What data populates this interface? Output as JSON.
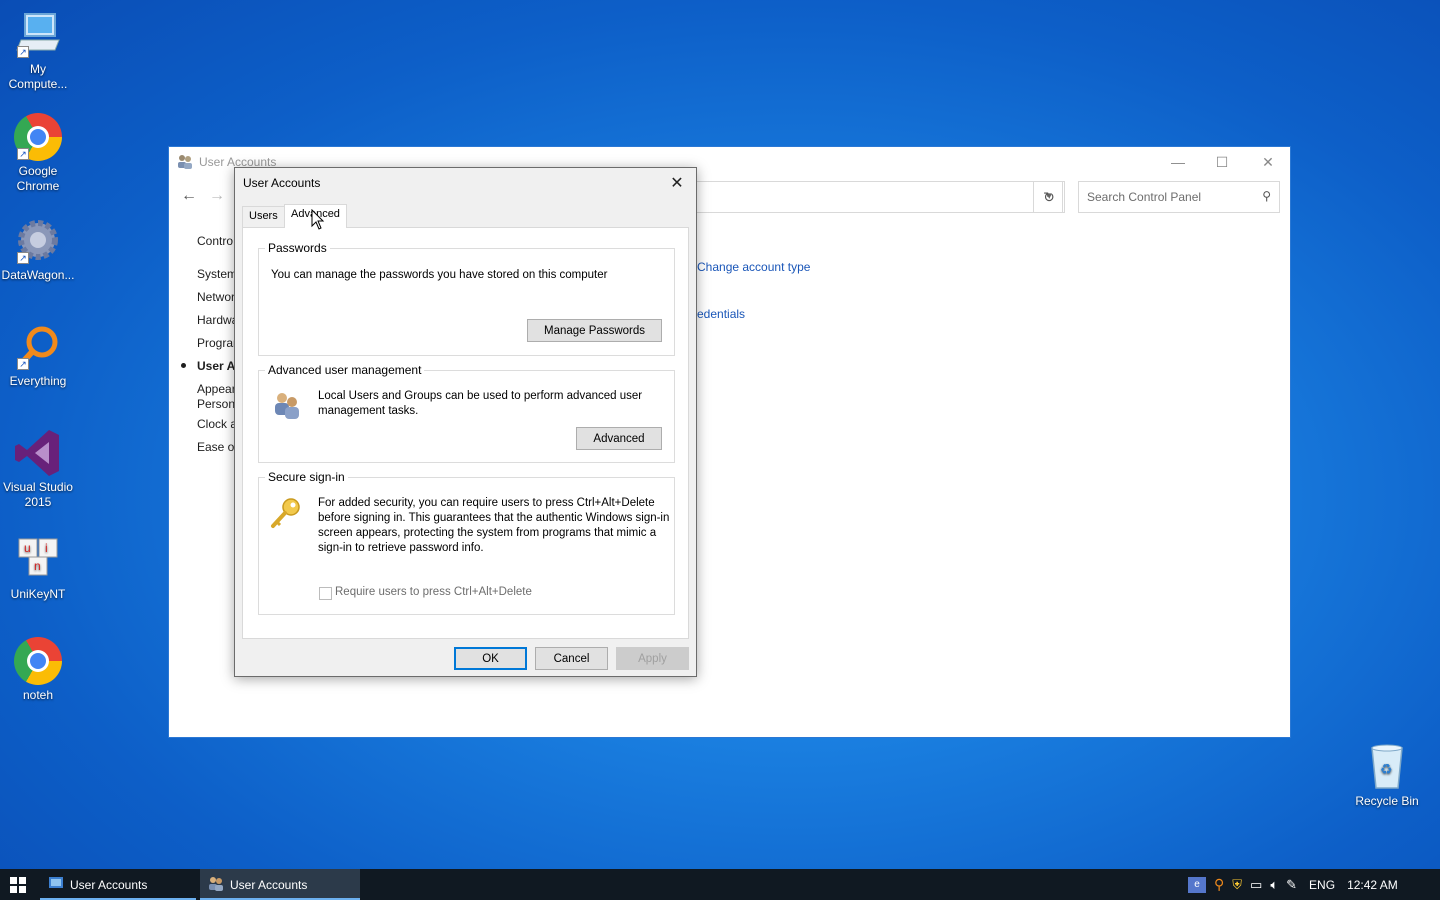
{
  "desktop": {
    "icons": [
      {
        "label": "My Compute...",
        "icon": "computer-icon"
      },
      {
        "label": "Google Chrome",
        "icon": "chrome-icon"
      },
      {
        "label": "DataWagon...",
        "icon": "gear-icon"
      },
      {
        "label": "Everything",
        "icon": "magnifier-icon"
      },
      {
        "label": "Visual Studio 2015",
        "icon": "visual-studio-icon"
      },
      {
        "label": "UniKeyNT",
        "icon": "unikey-icon"
      },
      {
        "label": "noteh",
        "icon": "chrome-icon"
      }
    ],
    "recycle_bin": "Recycle Bin"
  },
  "control_panel": {
    "title": "User Accounts",
    "search_placeholder": "Search Control Panel",
    "left_nav": [
      "Contro",
      "System",
      "Networ",
      "Hardwa",
      "Prograr",
      "User A",
      "Appear",
      "Person",
      "Clock a",
      "Ease of"
    ],
    "links": {
      "change_account_type": "Change account type",
      "credentials": "edentials"
    }
  },
  "dialog": {
    "title": "User Accounts",
    "tabs": [
      "Users",
      "Advanced"
    ],
    "active_tab": "Advanced",
    "passwords": {
      "label": "Passwords",
      "text": "You can manage the passwords you have stored on this computer",
      "button": "Manage Passwords"
    },
    "advanced_mgmt": {
      "label": "Advanced user management",
      "text": "Local Users and Groups can be used to perform advanced user management tasks.",
      "button": "Advanced"
    },
    "secure_signin": {
      "label": "Secure sign-in",
      "text": "For added security, you can require users to press Ctrl+Alt+Delete before signing in. This guarantees that the authentic Windows sign-in screen appears, protecting the system from programs that mimic a sign-in to retrieve password info.",
      "checkbox_label": "Require users to press Ctrl+Alt+Delete",
      "checkbox_checked": false
    },
    "buttons": {
      "ok": "OK",
      "cancel": "Cancel",
      "apply": "Apply"
    }
  },
  "taskbar": {
    "items": [
      "User Accounts",
      "User Accounts"
    ],
    "language": "ENG",
    "time": "12:42 AM"
  }
}
